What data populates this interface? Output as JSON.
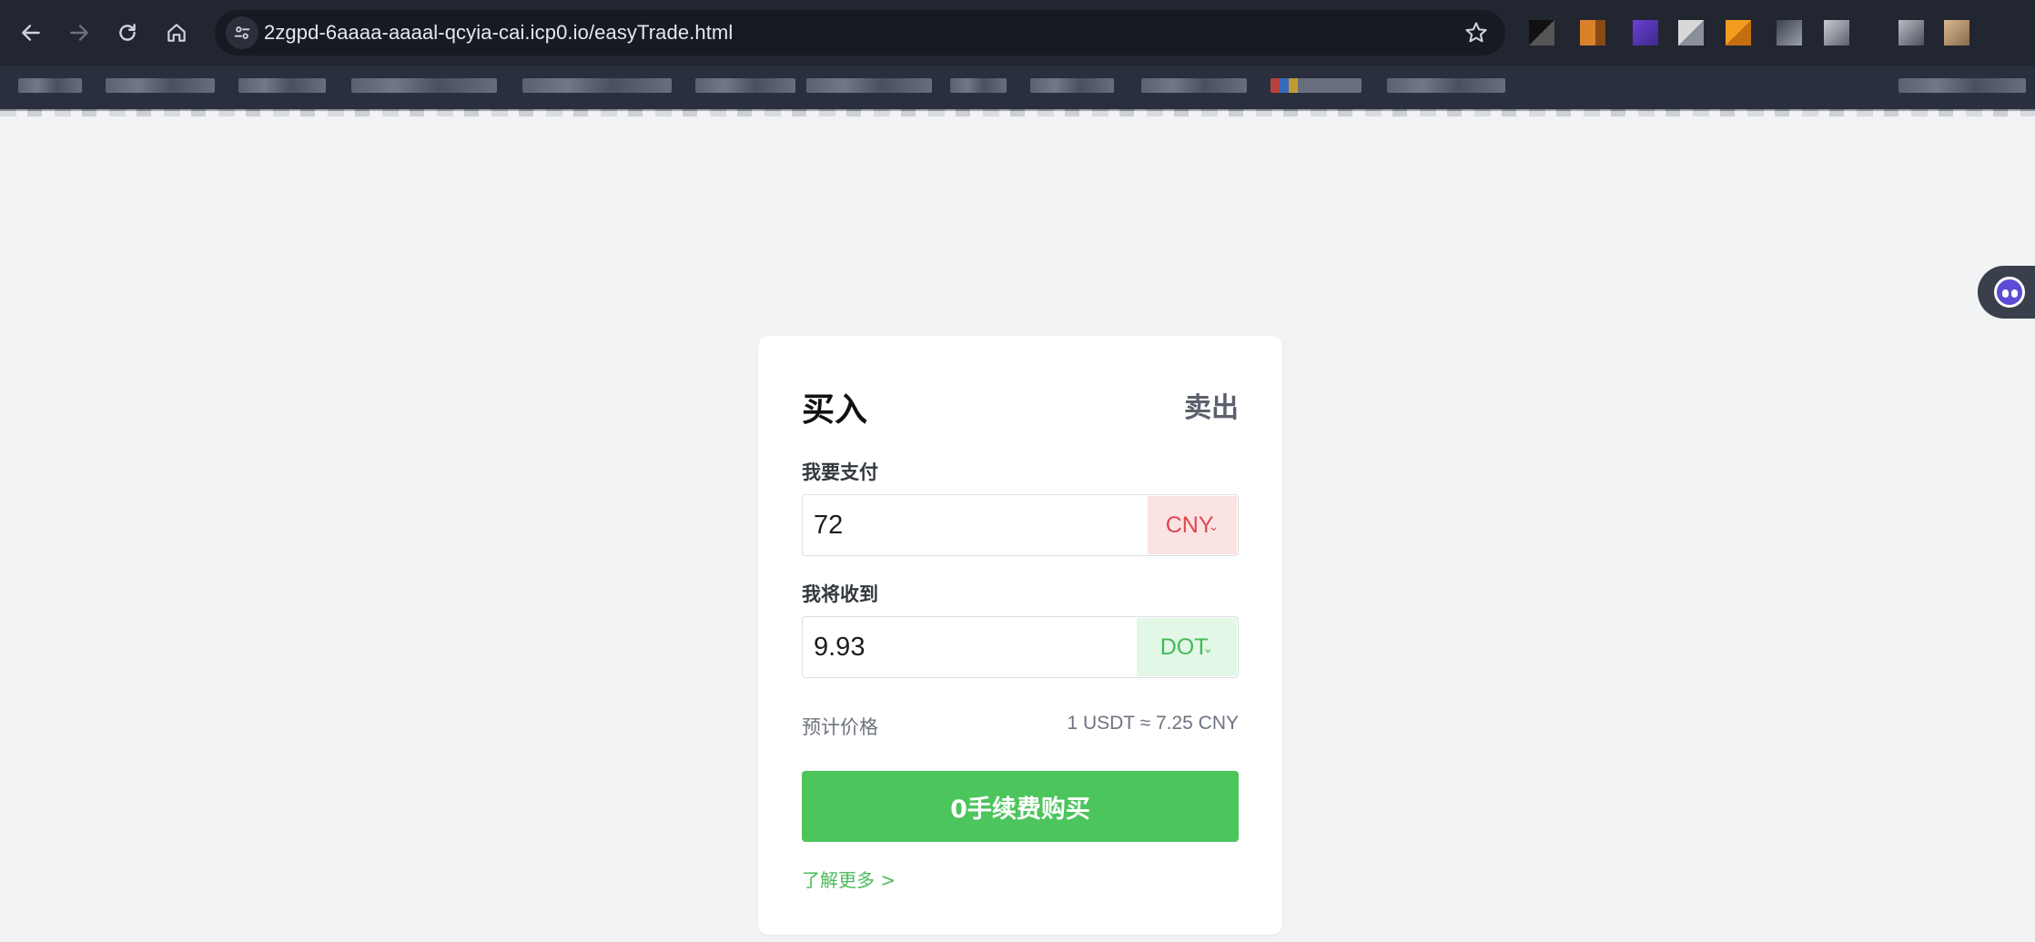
{
  "browser": {
    "url": "2zgpd-6aaaa-aaaal-qcyia-cai.icp0.io/easyTrade.html",
    "icons": {
      "back": "arrow-left-icon",
      "forward": "arrow-right-icon",
      "reload": "reload-icon",
      "home": "home-icon",
      "site_info": "tune-icon",
      "bookmark": "star-icon"
    }
  },
  "trade": {
    "tab_buy": "买入",
    "tab_sell": "卖出",
    "pay_label": "我要支付",
    "pay_value": "72",
    "pay_currency": "CNY",
    "receive_label": "我将收到",
    "receive_value": "9.93",
    "receive_currency": "DOT",
    "price_label": "预计价格",
    "price_value": "1 USDT ≈ 7.25 CNY",
    "buy_button": "0手续费购买",
    "learn_more": "了解更多 >",
    "colors": {
      "accent_green": "#4cc55c",
      "cny_bg": "#fbe3e4",
      "cny_text": "#e0474f",
      "dot_bg": "#e2f7e6",
      "dot_text": "#43b95a"
    }
  }
}
